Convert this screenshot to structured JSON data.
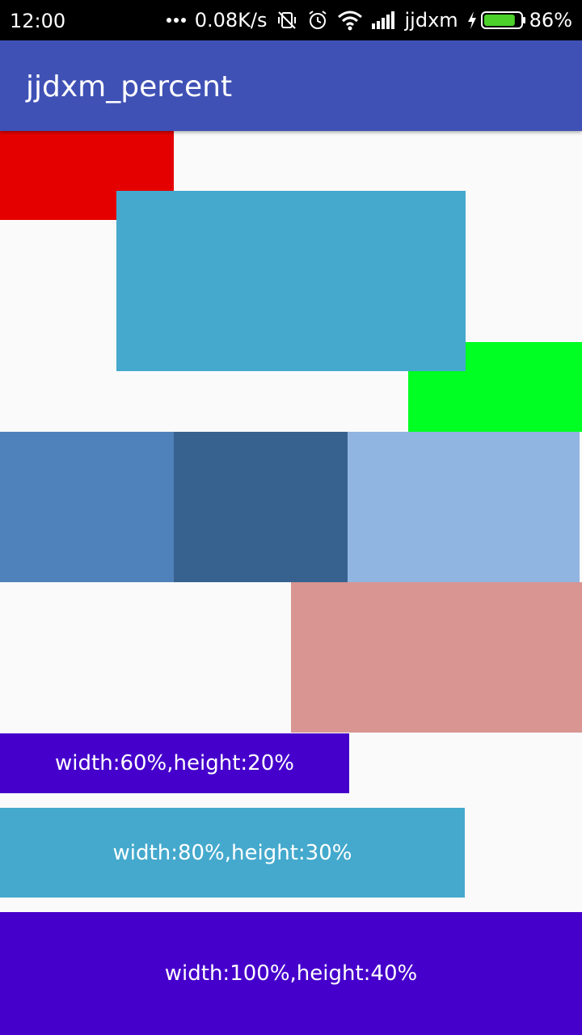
{
  "status_bar": {
    "time": "12:00",
    "network_speed": "0.08K/s",
    "carrier": "jjdxm",
    "battery_percent": "86%",
    "battery_level": 0.86,
    "icons": [
      "more-dots-icon",
      "mute-icon",
      "alarm-icon",
      "wifi-icon",
      "signal-icon",
      "charging-icon",
      "battery-icon"
    ]
  },
  "app_bar": {
    "title": "jjdxm_percent",
    "color": "#3f51b5"
  },
  "boxes": {
    "red": {
      "color": "#e50000"
    },
    "blue_center": {
      "color": "#44a9cd"
    },
    "green": {
      "color": "#00ff23"
    },
    "steel_1": {
      "color": "#4f82bb"
    },
    "steel_2": {
      "color": "#37628f"
    },
    "steel_3": {
      "color": "#90b5e0"
    },
    "pink": {
      "color": "#d89592"
    },
    "box_60_20": {
      "label": "width:60%,height:20%",
      "color": "#4600cb"
    },
    "box_80_30": {
      "label": "width:80%,height:30%",
      "color": "#44a9cd"
    },
    "box_100_40": {
      "label": "width:100%,height:40%",
      "color": "#4600cb"
    }
  }
}
